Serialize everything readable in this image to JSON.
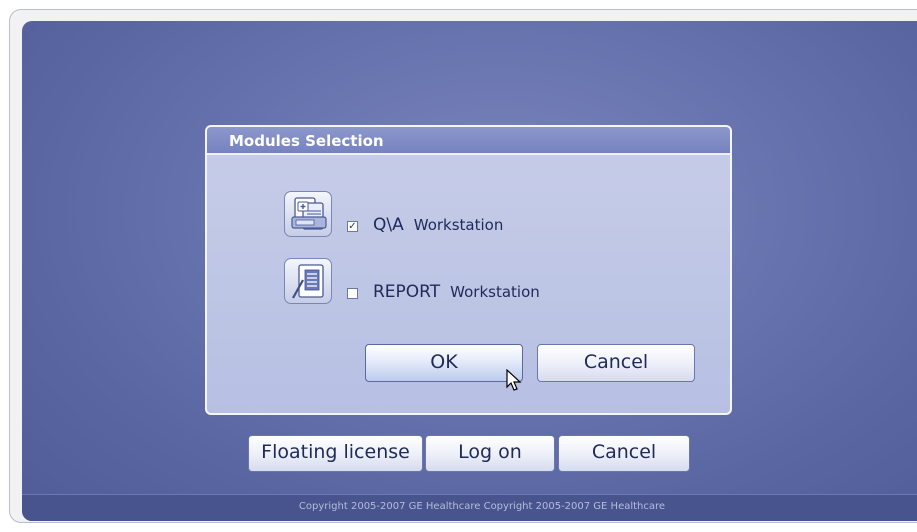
{
  "dialog": {
    "title": "Modules Selection",
    "modules": [
      {
        "name": "Q\\A",
        "suffix": "Workstation",
        "checked": true,
        "icon": "qa-workstation-icon"
      },
      {
        "name": "REPORT",
        "suffix": "Workstation",
        "checked": false,
        "icon": "report-workstation-icon"
      }
    ],
    "ok_label": "OK",
    "cancel_label": "Cancel"
  },
  "login": {
    "floating_license_label": "Floating license",
    "logon_label": "Log on",
    "cancel_label": "Cancel"
  },
  "footer": {
    "copyright": "Copyright 2005-2007 GE Healthcare Copyright 2005-2007 GE Healthcare"
  },
  "colors": {
    "background": "#5a66a2",
    "dialog": "#b7c0e3",
    "title_bar": "#7682bf",
    "text": "#1f2a5a"
  }
}
